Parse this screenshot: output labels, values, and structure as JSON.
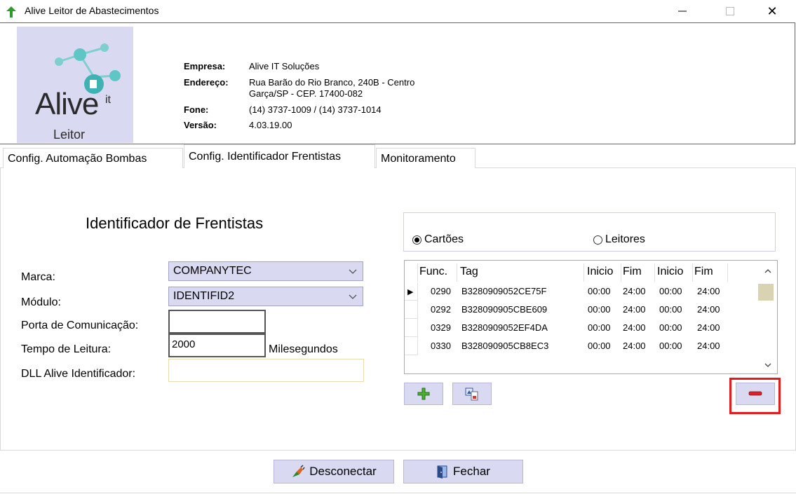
{
  "window": {
    "title": "Alive Leitor de Abastecimentos",
    "close_glyph": "✕"
  },
  "logo": {
    "word": "Alive",
    "superscript": "it",
    "subtitle": "Leitor"
  },
  "company": [
    {
      "label": "Empresa:",
      "value": "Alive IT Soluções"
    },
    {
      "label": "Endereço:",
      "value": "Rua Barão do Rio Branco, 240B - Centro"
    },
    {
      "label": "",
      "value": "Garça/SP - CEP. 17400-082"
    },
    {
      "label": "Fone:",
      "value": "(14) 3737-1009 / (14) 3737-1014"
    },
    {
      "label": "Versão:",
      "value": "4.03.19.00"
    }
  ],
  "tabs": [
    {
      "label": "Config. Automação Bombas"
    },
    {
      "label": "Config. Identificador Frentistas"
    },
    {
      "label": "Monitoramento"
    }
  ],
  "form": {
    "title": "Identificador de Frentistas",
    "marca_label": "Marca:",
    "marca_value": "COMPANYTEC",
    "modulo_label": "Módulo:",
    "modulo_value": "IDENTIFID2",
    "porta_label": "Porta de Comunicação:",
    "porta_value": "",
    "tempo_label": "Tempo de Leitura:",
    "tempo_value": "2000",
    "tempo_unit": "Milesegundos",
    "dll_label": "DLL Alive Identificador:",
    "dll_value": ""
  },
  "radios": [
    {
      "label": "Cartões",
      "selected": true
    },
    {
      "label": "Leitores",
      "selected": false
    }
  ],
  "grid": {
    "headers": [
      "Func.",
      "Tag",
      "Inicio",
      "Fim",
      "Inicio",
      "Fim"
    ],
    "rows": [
      [
        "0290",
        "B3280909052CE75F",
        "00:00",
        "24:00",
        "00:00",
        "24:00"
      ],
      [
        "0292",
        "B328090905CBE609",
        "00:00",
        "24:00",
        "00:00",
        "24:00"
      ],
      [
        "0329",
        "B3280909052EF4DA",
        "00:00",
        "24:00",
        "00:00",
        "24:00"
      ],
      [
        "0330",
        "B328090905CB8EC3",
        "00:00",
        "24:00",
        "00:00",
        "24:00"
      ]
    ],
    "current_row_indicator": "▶"
  },
  "buttons": {
    "disconnect": "Desconectar",
    "close": "Fechar"
  },
  "colors": {
    "accent_panel": "#d9d9f2",
    "highlight": "#e31b1b",
    "logo_teal": "#5fc6c6"
  }
}
